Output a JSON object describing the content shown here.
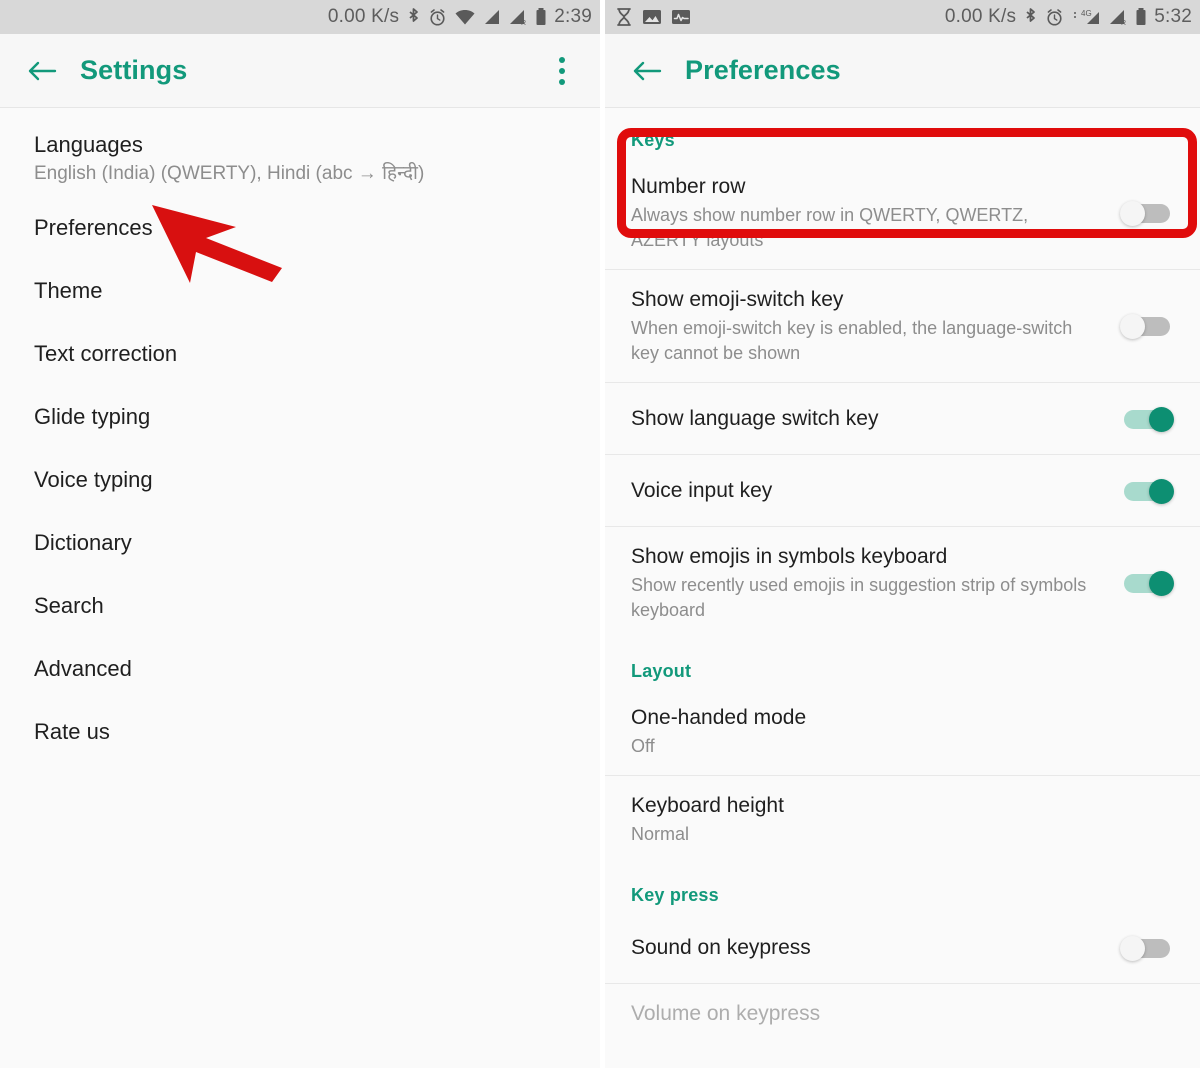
{
  "accent_color": "#12997b",
  "highlight_color": "#e00c0c",
  "toggle_on_color": "#0d8f72",
  "toggle_off_color": "#bdbdbd",
  "left_screen": {
    "status_bar": {
      "network_speed": "0.00 K/s",
      "time": "2:39",
      "icons": [
        "bluetooth-icon",
        "alarm-icon",
        "wifi-icon",
        "signal-icon",
        "signal-roaming-icon",
        "battery-icon"
      ]
    },
    "app_bar": {
      "back_label": "back-arrow",
      "title": "Settings",
      "overflow_label": "more-options"
    },
    "items": [
      {
        "title": "Languages",
        "subtitle": "English (India) (QWERTY), Hindi (abc → हिन्दी)"
      },
      {
        "title": "Preferences",
        "subtitle": ""
      },
      {
        "title": "Theme",
        "subtitle": ""
      },
      {
        "title": "Text correction",
        "subtitle": ""
      },
      {
        "title": "Glide typing",
        "subtitle": ""
      },
      {
        "title": "Voice typing",
        "subtitle": ""
      },
      {
        "title": "Dictionary",
        "subtitle": ""
      },
      {
        "title": "Search",
        "subtitle": ""
      },
      {
        "title": "Advanced",
        "subtitle": ""
      },
      {
        "title": "Rate us",
        "subtitle": ""
      }
    ],
    "annotation": {
      "type": "arrow",
      "points_to": "Preferences",
      "color": "#d81010"
    }
  },
  "right_screen": {
    "status_bar": {
      "network_speed": "0.00 K/s",
      "time": "5:32",
      "network_type": "4G",
      "left_icons": [
        "hourglass-icon",
        "image-icon",
        "activity-icon"
      ],
      "right_icons": [
        "bluetooth-icon",
        "alarm-icon",
        "signal-4g-icon",
        "signal-roaming-icon",
        "battery-icon"
      ]
    },
    "app_bar": {
      "back_label": "back-arrow",
      "title": "Preferences"
    },
    "sections": [
      {
        "heading": "Keys",
        "rows": [
          {
            "title": "Number row",
            "subtitle": "Always show number row in QWERTY, QWERTZ, AZERTY layouts",
            "control": "toggle",
            "state": "off",
            "highlighted": true
          },
          {
            "title": "Show emoji-switch key",
            "subtitle": "When emoji-switch key is enabled, the language-switch key cannot be shown",
            "control": "toggle",
            "state": "off",
            "highlighted": false
          },
          {
            "title": "Show language switch key",
            "subtitle": "",
            "control": "toggle",
            "state": "on",
            "highlighted": false
          },
          {
            "title": "Voice input key",
            "subtitle": "",
            "control": "toggle",
            "state": "on",
            "highlighted": false
          },
          {
            "title": "Show emojis in symbols keyboard",
            "subtitle": "Show recently used emojis in suggestion strip of symbols keyboard",
            "control": "toggle",
            "state": "on",
            "highlighted": false
          }
        ]
      },
      {
        "heading": "Layout",
        "rows": [
          {
            "title": "One-handed mode",
            "subtitle": "Off",
            "control": "none",
            "state": "",
            "highlighted": false
          },
          {
            "title": "Keyboard height",
            "subtitle": "Normal",
            "control": "none",
            "state": "",
            "highlighted": false
          }
        ]
      },
      {
        "heading": "Key press",
        "rows": [
          {
            "title": "Sound on keypress",
            "subtitle": "",
            "control": "toggle",
            "state": "off",
            "highlighted": false
          },
          {
            "title": "Volume on keypress",
            "subtitle": "",
            "control": "none",
            "state": "disabled",
            "highlighted": false
          }
        ]
      }
    ]
  }
}
